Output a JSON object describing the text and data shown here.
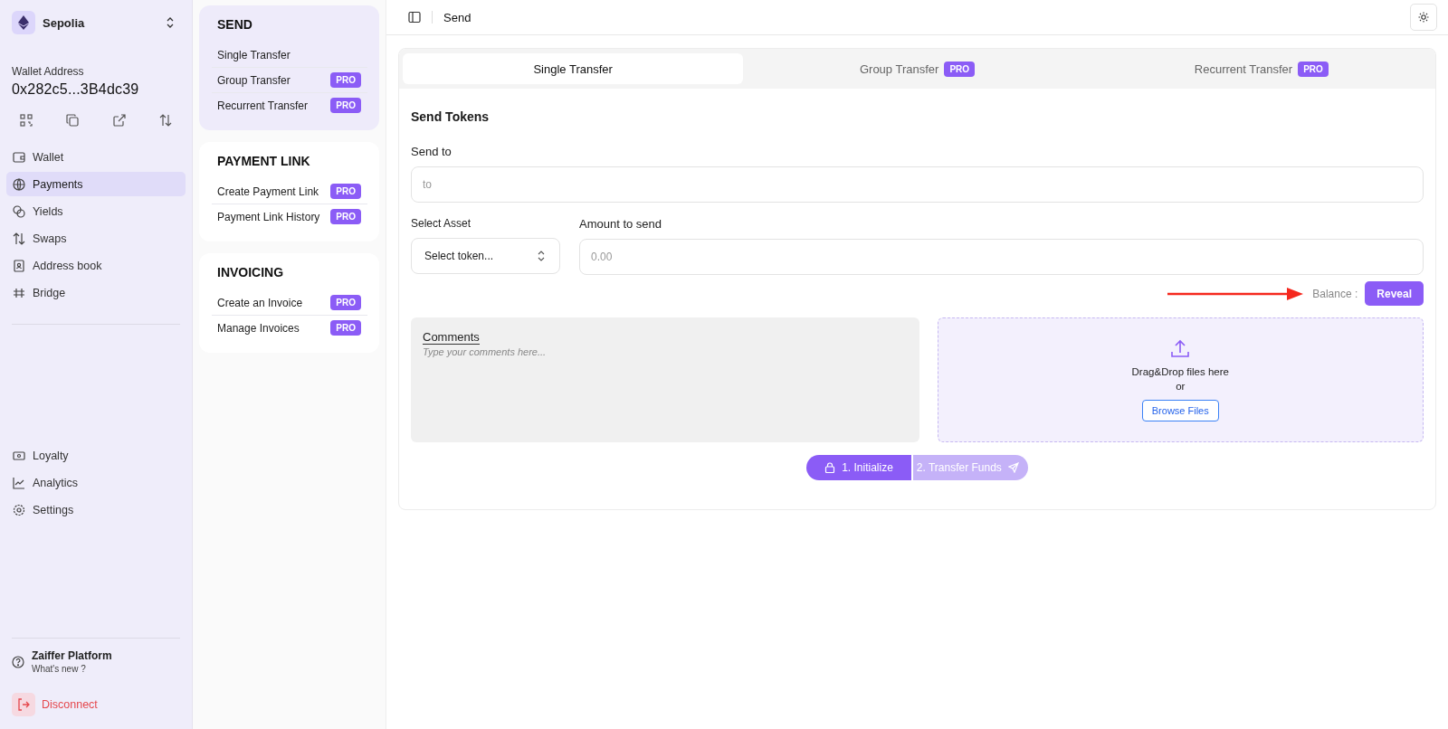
{
  "network": {
    "name": "Sepolia"
  },
  "wallet": {
    "label": "Wallet Address",
    "address": "0x282c5...3B4dc39"
  },
  "nav_main": [
    {
      "label": "Wallet",
      "selected": false
    },
    {
      "label": "Payments",
      "selected": true
    },
    {
      "label": "Yields",
      "selected": false
    },
    {
      "label": "Swaps",
      "selected": false
    },
    {
      "label": "Address book",
      "selected": false
    },
    {
      "label": "Bridge",
      "selected": false
    }
  ],
  "nav_bottom": [
    {
      "label": "Loyalty",
      "selected": false
    },
    {
      "label": "Analytics",
      "selected": false
    },
    {
      "label": "Settings",
      "selected": false
    }
  ],
  "platform": {
    "title": "Zaiffer Platform",
    "subtitle": "What's new ?"
  },
  "disconnect": {
    "label": "Disconnect"
  },
  "menu_sections": [
    {
      "title": "SEND",
      "selected": true,
      "items": [
        {
          "label": "Single Transfer"
        },
        {
          "label": "Group Transfer",
          "badge": "PRO"
        },
        {
          "label": "Recurrent Transfer",
          "badge": "PRO"
        }
      ]
    },
    {
      "title": "PAYMENT LINK",
      "selected": false,
      "items": [
        {
          "label": "Create Payment Link",
          "badge": "PRO"
        },
        {
          "label": "Payment Link History",
          "badge": "PRO"
        }
      ]
    },
    {
      "title": "INVOICING",
      "selected": false,
      "items": [
        {
          "label": "Create an Invoice",
          "badge": "PRO"
        },
        {
          "label": "Manage Invoices",
          "badge": "PRO"
        }
      ]
    }
  ],
  "topbar": {
    "title": "Send"
  },
  "tabs": [
    {
      "label": "Single Transfer",
      "selected": true
    },
    {
      "label": "Group Transfer",
      "badge": "PRO",
      "selected": false
    },
    {
      "label": "Recurrent Transfer",
      "badge": "PRO",
      "selected": false
    }
  ],
  "form": {
    "heading": "Send Tokens",
    "send_to": {
      "label": "Send to",
      "placeholder": "to"
    },
    "asset": {
      "label": "Select Asset",
      "placeholder": "Select token..."
    },
    "amount": {
      "label": "Amount to send",
      "placeholder": "0.00"
    },
    "balance": {
      "label": "Balance :",
      "button": "Reveal"
    },
    "comments": {
      "label": "Comments",
      "placeholder": "Type your comments here..."
    },
    "upload": {
      "text": "Drag&Drop files here",
      "or": "or",
      "button": "Browse Files"
    },
    "steps": [
      {
        "label": "1. Initialize",
        "disabled": false
      },
      {
        "label": "2. Transfer Funds",
        "disabled": true
      }
    ]
  }
}
